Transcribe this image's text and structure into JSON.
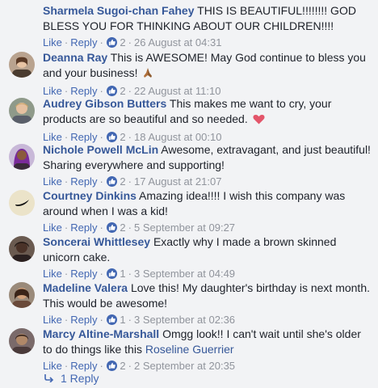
{
  "comments": [
    {
      "name": "Sharmela Sugoi-chan Fahey",
      "text": "THIS IS BEAUTIFUL!!!!!!!! GOD BLESS YOU FOR THINKING ABOUT OUR CHILDREN!!!!",
      "like": "Like",
      "reply": "Reply",
      "likes": "2",
      "time": "26 August at 04:31",
      "avatar_color": "#6b8fb5"
    },
    {
      "name": "Deanna Ray",
      "text": "This is AWESOME! May God continue to bless you and your business!",
      "emoji": "pray",
      "like": "Like",
      "reply": "Reply",
      "likes": "2",
      "time": "22 August at 11:10",
      "avatar_color": "#9a7a62"
    },
    {
      "name": "Audrey Gibson Butters",
      "text": "This makes me want to cry, your products are so beautiful and so needed.",
      "emoji": "heart",
      "like": "Like",
      "reply": "Reply",
      "likes": "2",
      "time": "18 August at 00:10",
      "avatar_color": "#8b7b6b"
    },
    {
      "name": "Nichole Powell McLin",
      "text": "Awesome, extravagant, and just beautiful! Sharing everywhere and supporting!",
      "like": "Like",
      "reply": "Reply",
      "likes": "2",
      "time": "17 August at 21:07",
      "avatar_color": "#8a4aa8"
    },
    {
      "name": "Courtney Dinkins",
      "text": "Amazing idea!!!! I wish this company was around when I was a kid!",
      "like": "Like",
      "reply": "Reply",
      "likes": "2",
      "time": "5 September at 09:27",
      "avatar_color": "#e8e0c8"
    },
    {
      "name": "Soncerai Whittlesey",
      "text": "Exactly why I made a brown skinned unicorn cake.",
      "like": "Like",
      "reply": "Reply",
      "likes": "1",
      "time": "3 September at 04:49",
      "avatar_color": "#4a3a32"
    },
    {
      "name": "Madeline Valera",
      "text": "Love this! My daughter's birthday is next month. This would be awesome!",
      "like": "Like",
      "reply": "Reply",
      "likes": "1",
      "time": "3 September at 02:36",
      "avatar_color": "#7a5a4a"
    },
    {
      "name": "Marcy Altine-Marshall",
      "text": "Omgg look!! I can't wait until she's older to do things like this",
      "mention": "Roseline Guerrier",
      "like": "Like",
      "reply": "Reply",
      "likes": "2",
      "time": "2 September at 20:35",
      "avatar_color": "#6a5a58"
    }
  ],
  "replies_link": "1 Reply",
  "colors": {
    "background": "#f2f3f5",
    "name_link": "#365899",
    "action_link": "#4267b2",
    "meta_grey": "#90949c"
  }
}
